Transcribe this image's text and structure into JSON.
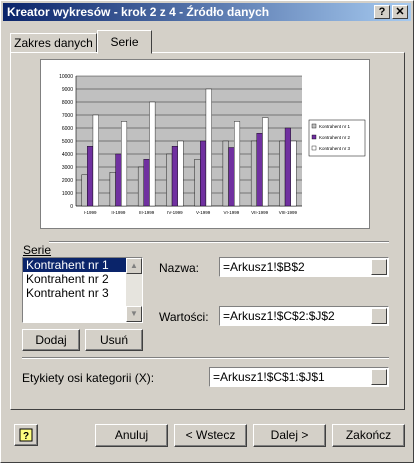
{
  "window": {
    "title": "Kreator wykresów - krok 2 z 4 - Źródło danych",
    "help_btn": "?",
    "close_btn": "✕"
  },
  "tabs": [
    {
      "label": "Zakres danych"
    },
    {
      "label": "Serie"
    }
  ],
  "chart_data": {
    "type": "bar",
    "categories": [
      "I-1999",
      "II-1999",
      "III-1999",
      "IV-1999",
      "V-1999",
      "VI-1999",
      "VII-1999",
      "VIII-1999"
    ],
    "series": [
      {
        "name": "Kontrahent nr 1",
        "values": [
          2400,
          2600,
          3000,
          4000,
          3600,
          5000,
          5000,
          5000
        ]
      },
      {
        "name": "Kontrahent nr 2",
        "values": [
          4600,
          4000,
          3600,
          4600,
          5000,
          4500,
          5600,
          6000
        ]
      },
      {
        "name": "Kontrahent nr 3",
        "values": [
          7000,
          6500,
          8000,
          5000,
          9000,
          6500,
          6800,
          5000
        ]
      }
    ],
    "ylim": [
      0,
      10000
    ],
    "yticks": [
      "0",
      "1000",
      "2000",
      "3000",
      "4000",
      "5000",
      "6000",
      "7000",
      "8000",
      "9000",
      "10000"
    ],
    "legend": "right",
    "colors": [
      "#c0c0c0",
      "#7030a0",
      "#ffffff"
    ]
  },
  "series_group": {
    "label": "Serie",
    "items": [
      "Kontrahent nr 1",
      "Kontrahent nr 2",
      "Kontrahent nr 3"
    ],
    "add_label": "Dodaj",
    "remove_label": "Usuń",
    "name_label": "Nazwa:",
    "name_value": "=Arkusz1!$B$2",
    "values_label": "Wartości:",
    "values_value": "=Arkusz1!$C$2:$J$2"
  },
  "category_labels": {
    "label": "Etykiety osi kategorii (X):",
    "value": "=Arkusz1!$C$1:$J$1"
  },
  "footer": {
    "cancel": "Anuluj",
    "back": "< Wstecz",
    "next": "Dalej >",
    "finish": "Zakończ"
  }
}
